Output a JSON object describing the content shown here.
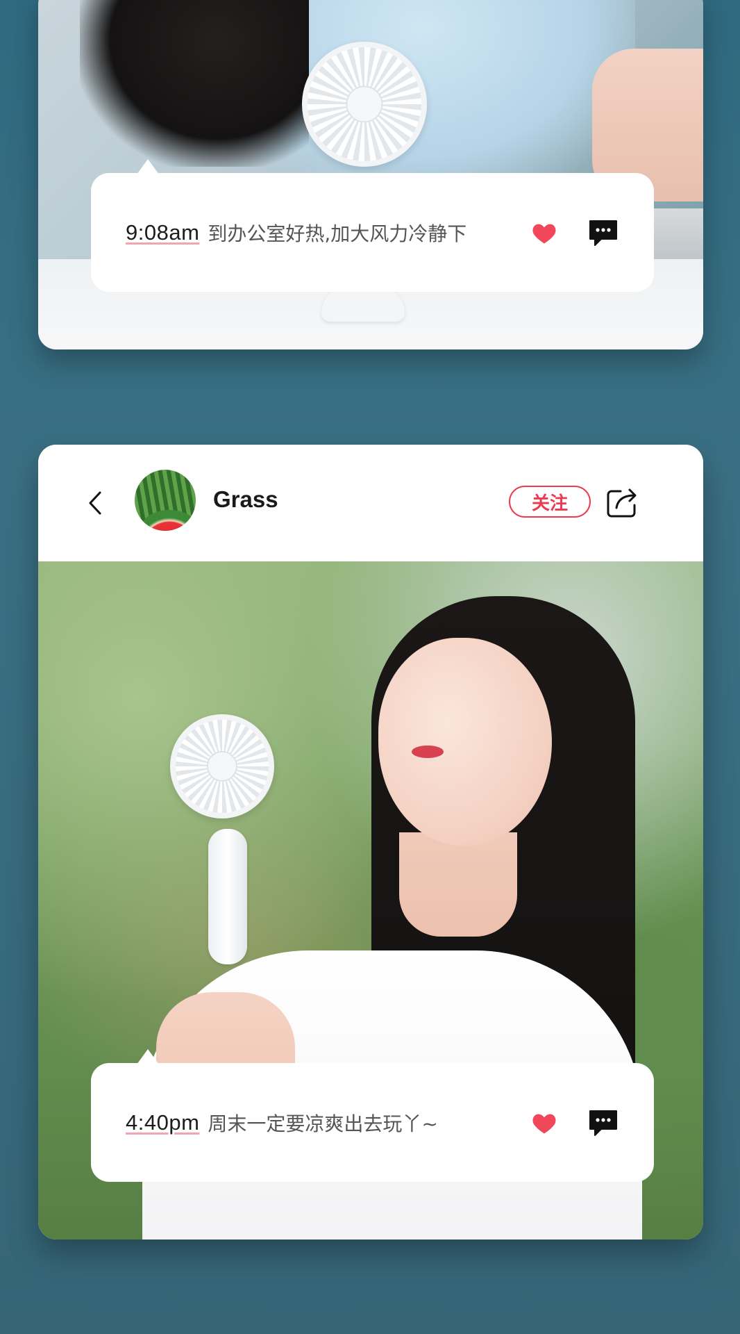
{
  "posts": [
    {
      "caption": {
        "time": "9:08am",
        "text": "到办公室好热,加大风力冷静下"
      }
    },
    {
      "header": {
        "username": "Grass",
        "follow_label": "关注"
      },
      "caption": {
        "time": "4:40pm",
        "text": "周末一定要凉爽出去玩丫~"
      }
    }
  ],
  "colors": {
    "background": "#356b7f",
    "accent_red": "#ec3a4f",
    "heart": "#f0475a",
    "time_underline": "#f2a5b0"
  },
  "icons": {
    "back": "chevron-left-icon",
    "share": "share-icon",
    "like": "heart-icon",
    "comment": "comment-icon"
  }
}
